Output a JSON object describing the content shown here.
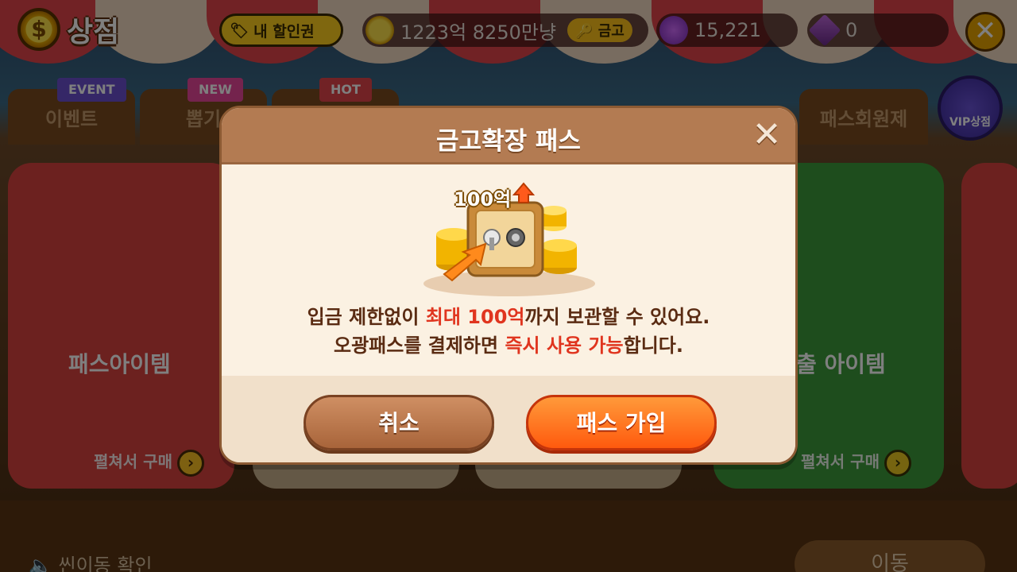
{
  "header": {
    "title": "상점",
    "coupon_label": "내 할인권",
    "gold_amount": "1223억 8250만냥",
    "vault_label": "금고",
    "gem_amount": "15,221",
    "ticket_amount": "0"
  },
  "tabs": [
    {
      "label": "이벤트",
      "tag": "EVENT"
    },
    {
      "label": "뽑기",
      "tag": "NEW"
    },
    {
      "label": "",
      "tag": "HOT"
    },
    {
      "label": "패스회원제",
      "tag": ""
    }
  ],
  "vip_label": "VIP상점",
  "cards": {
    "pass_item_label": "패스아이템",
    "pass_item_action": "펼쳐서 구매",
    "right_item_label": "출 아이템",
    "right_item_action": "펼쳐서 구매"
  },
  "bottom": {
    "left_text": "씬이동 확인",
    "right_button": "이동"
  },
  "popup": {
    "title": "금고확장 패스",
    "close_symbol": "✕",
    "badge_text": "100억",
    "line1_pre": "입금 제한없이 ",
    "line1_hl": "최대 100억",
    "line1_post": "까지 보관할 수 있어요.",
    "line2_pre": "오광패스를 결제하면 ",
    "line2_hl": "즉시 사용 가능",
    "line2_post": "합니다.",
    "cancel_label": "취소",
    "join_label": "패스 가입"
  },
  "colors": {
    "highlight": "#e0351f",
    "text_brown": "#5a2b12",
    "join_orange": "#ff5a0e",
    "cancel_brown": "#a8643a"
  }
}
